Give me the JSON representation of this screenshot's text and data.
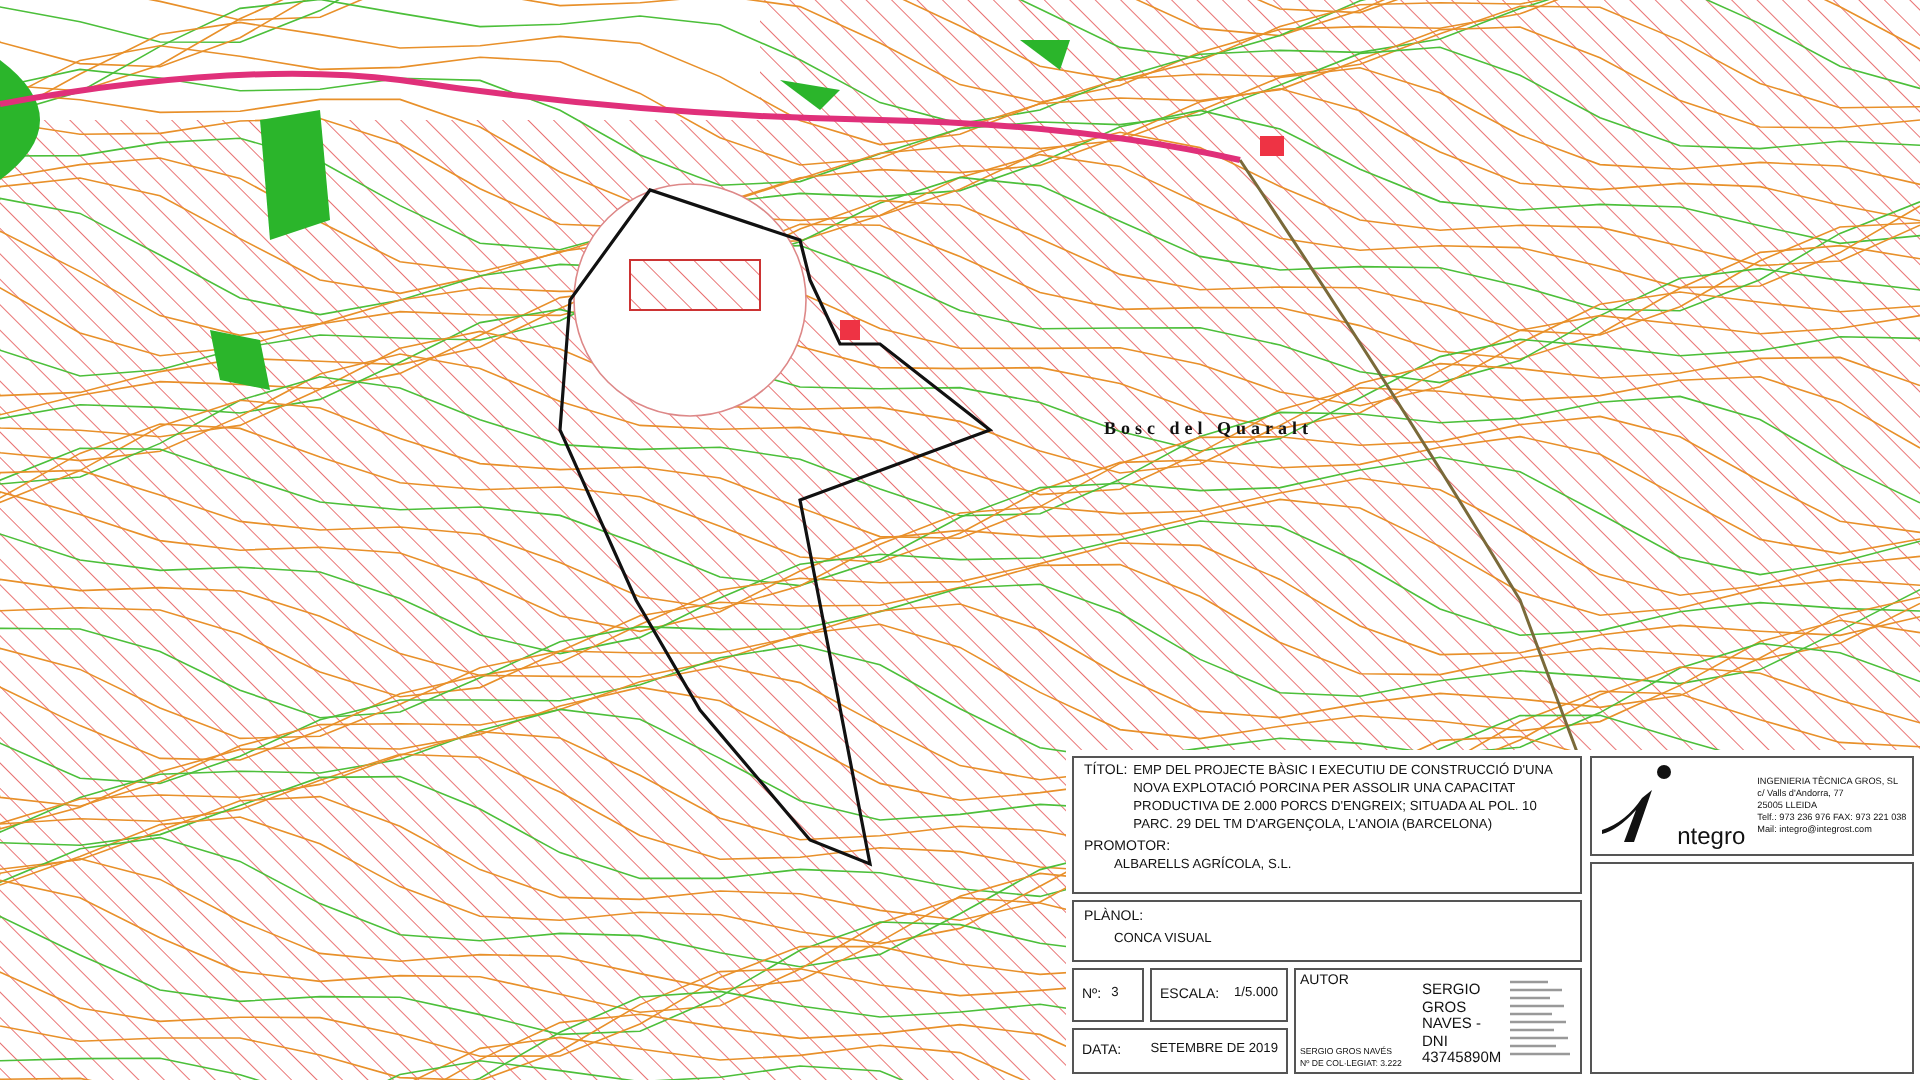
{
  "map": {
    "labels": [
      {
        "text": "Bosc del Quaralt"
      }
    ]
  },
  "title_block": {
    "titol_label": "TÍTOL:",
    "titol_lines": [
      "EMP DEL PROJECTE BÀSIC I EXECUTIU DE CONSTRUCCIÓ D'UNA",
      "NOVA EXPLOTACIÓ PORCINA PER ASSOLIR UNA CAPACITAT",
      "PRODUCTIVA DE 2.000 PORCS D'ENGREIX; SITUADA AL POL. 10",
      "PARC. 29 DEL TM D'ARGENÇOLA, L'ANOIA (BARCELONA)"
    ],
    "promotor_label": "PROMOTOR:",
    "promotor": "ALBARELLS AGRÍCOLA, S.L.",
    "planol_label": "PLÀNOL:",
    "planol": "CONCA VISUAL",
    "numero_label": "Nº:",
    "numero": "3",
    "escala_label": "ESCALA:",
    "escala": "1/5.000",
    "data_label": "DATA:",
    "data": "SETEMBRE DE 2019",
    "autor_label": "AUTOR",
    "autor_name": "SERGIO GROS NAVÉS",
    "autor_colegiat": "Nº DE COL·LEGIAT: 3.222",
    "signature_lines": [
      "SERGIO",
      "GROS",
      "NAVES -",
      "DNI",
      "43745890M"
    ],
    "logo_text": "ntegro",
    "company_lines": [
      "INGENIERIA TÈCNICA GROS, SL",
      "c/ Valls d'Andorra, 77",
      "25005 LLEIDA",
      "Telf.: 973 236 976 FAX: 973 221 038",
      "Mail: integro@integrost.com"
    ]
  }
}
